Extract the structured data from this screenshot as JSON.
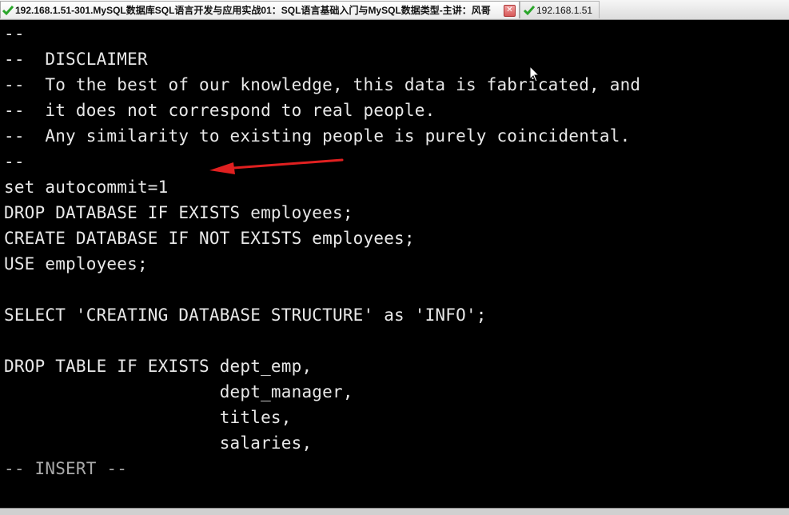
{
  "tabs": [
    {
      "title": "192.168.1.51-301.MySQL数据库SQL语言开发与应用实战01：SQL语言基础入门与MySQL数据类型-主讲：风哥",
      "active": true,
      "icon": "check-icon",
      "close_symbol": "✕"
    },
    {
      "title": "192.168.1.51",
      "active": false,
      "icon": "check-icon"
    }
  ],
  "terminal": {
    "lines": [
      "--",
      "--  DISCLAIMER",
      "--  To the best of our knowledge, this data is fabricated, and",
      "--  it does not correspond to real people.",
      "--  Any similarity to existing people is purely coincidental.",
      "--",
      "set autocommit=1",
      "DROP DATABASE IF EXISTS employees;",
      "CREATE DATABASE IF NOT EXISTS employees;",
      "USE employees;",
      "",
      "SELECT 'CREATING DATABASE STRUCTURE' as 'INFO';",
      "",
      "DROP TABLE IF EXISTS dept_emp,",
      "                     dept_manager,",
      "                     titles,",
      "                     salaries,"
    ],
    "mode_line": "-- INSERT --"
  },
  "colors": {
    "terminal_bg": "#000000",
    "text": "#e8e8e8",
    "mode_text": "#a9a9a9",
    "annotation_arrow": "#e02020",
    "check": "#2aa52a"
  },
  "annotation": {
    "type": "arrow",
    "points_to": "set autocommit=1"
  }
}
